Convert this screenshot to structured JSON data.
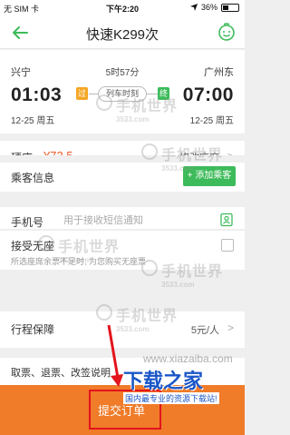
{
  "status_bar": {
    "carrier": "无 SIM 卡",
    "time": "下午2:20",
    "battery": "36%",
    "battery_level": 0.36
  },
  "nav": {
    "title": "快速K299次",
    "back_icon": "back-arrow-icon",
    "service_icon": "customer-service-icon"
  },
  "trip": {
    "from_station": "兴宁",
    "to_station": "广州东",
    "duration": "5时57分",
    "depart_time": "01:03",
    "arrive_time": "07:00",
    "depart_tag": "过",
    "arrive_tag": "终",
    "timetable_label": "列车时刻",
    "depart_date": "12-25  周五",
    "arrive_date": "12-25  周五"
  },
  "seat": {
    "label": "硬座:",
    "price": "¥72.5",
    "change_label": "修改座席"
  },
  "passenger": {
    "label": "乘客信息",
    "add_label": "+ 添加乘客"
  },
  "phone": {
    "label": "手机号",
    "placeholder": "用于接收短信通知"
  },
  "no_standing": {
    "label": "接受无座",
    "hint": "所选座席余票不足时, 为您购买无座票"
  },
  "insurance": {
    "label": "行程保障",
    "value": "5元/人"
  },
  "notice": {
    "label": "取票、退票、改签说明"
  },
  "submit": {
    "label": "提交订单"
  },
  "watermarks": {
    "site": "手机世界",
    "site_url": "3533.com",
    "download_brand": "下载之家",
    "download_slogan": "国内最专业的资源下载站!",
    "download_url": "www.xiazaiba.com"
  },
  "colors": {
    "accent_green": "#3dbb5a",
    "price_orange": "#f05a28",
    "submit_orange": "#f07b29",
    "highlight_red": "#e3141c",
    "brand_blue": "#1a56c8"
  }
}
